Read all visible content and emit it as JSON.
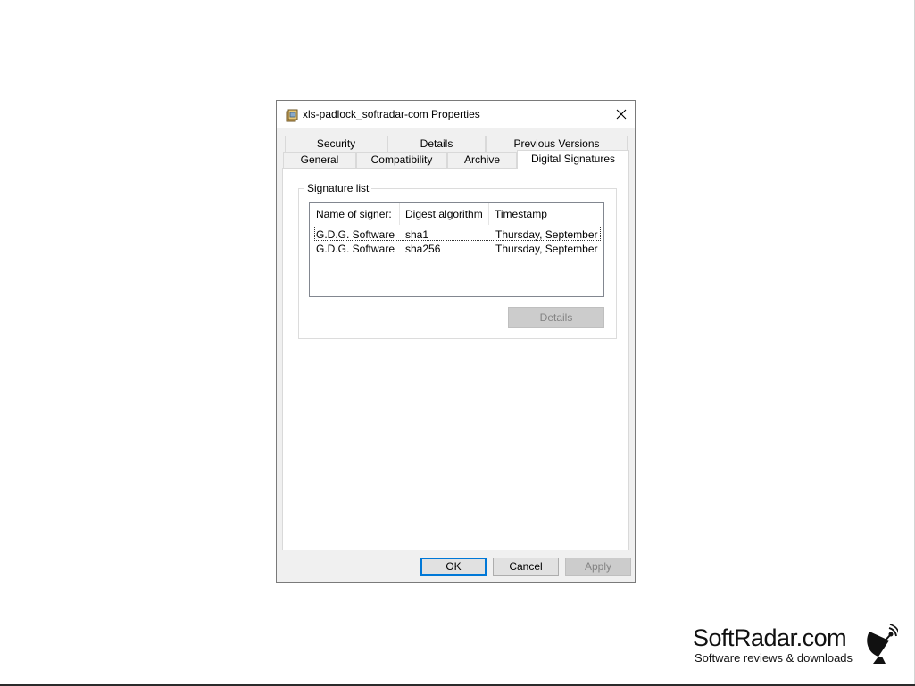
{
  "window": {
    "title": "xls-padlock_softradar-com Properties",
    "close_glyph": "✕"
  },
  "tabs": {
    "row1": [
      "Security",
      "Details",
      "Previous Versions"
    ],
    "row2": [
      "General",
      "Compatibility",
      "Archive",
      "Digital Signatures"
    ],
    "active": "Digital Signatures"
  },
  "signatures": {
    "group_label": "Signature list",
    "columns": [
      "Name of signer:",
      "Digest algorithm",
      "Timestamp"
    ],
    "rows": [
      {
        "signer": "G.D.G. Software ...",
        "digest": "sha1",
        "timestamp": "Thursday, September ..."
      },
      {
        "signer": "G.D.G. Software ...",
        "digest": "sha256",
        "timestamp": "Thursday, September ..."
      }
    ],
    "details_label": "Details"
  },
  "buttons": {
    "ok": "OK",
    "cancel": "Cancel",
    "apply": "Apply"
  },
  "brand": {
    "name": "SoftRadar.com",
    "tagline": "Software reviews & downloads"
  },
  "colors": {
    "focus_blue": "#0078d7",
    "dialog_bg": "#f0f0f0",
    "disabled_text": "#838383"
  }
}
